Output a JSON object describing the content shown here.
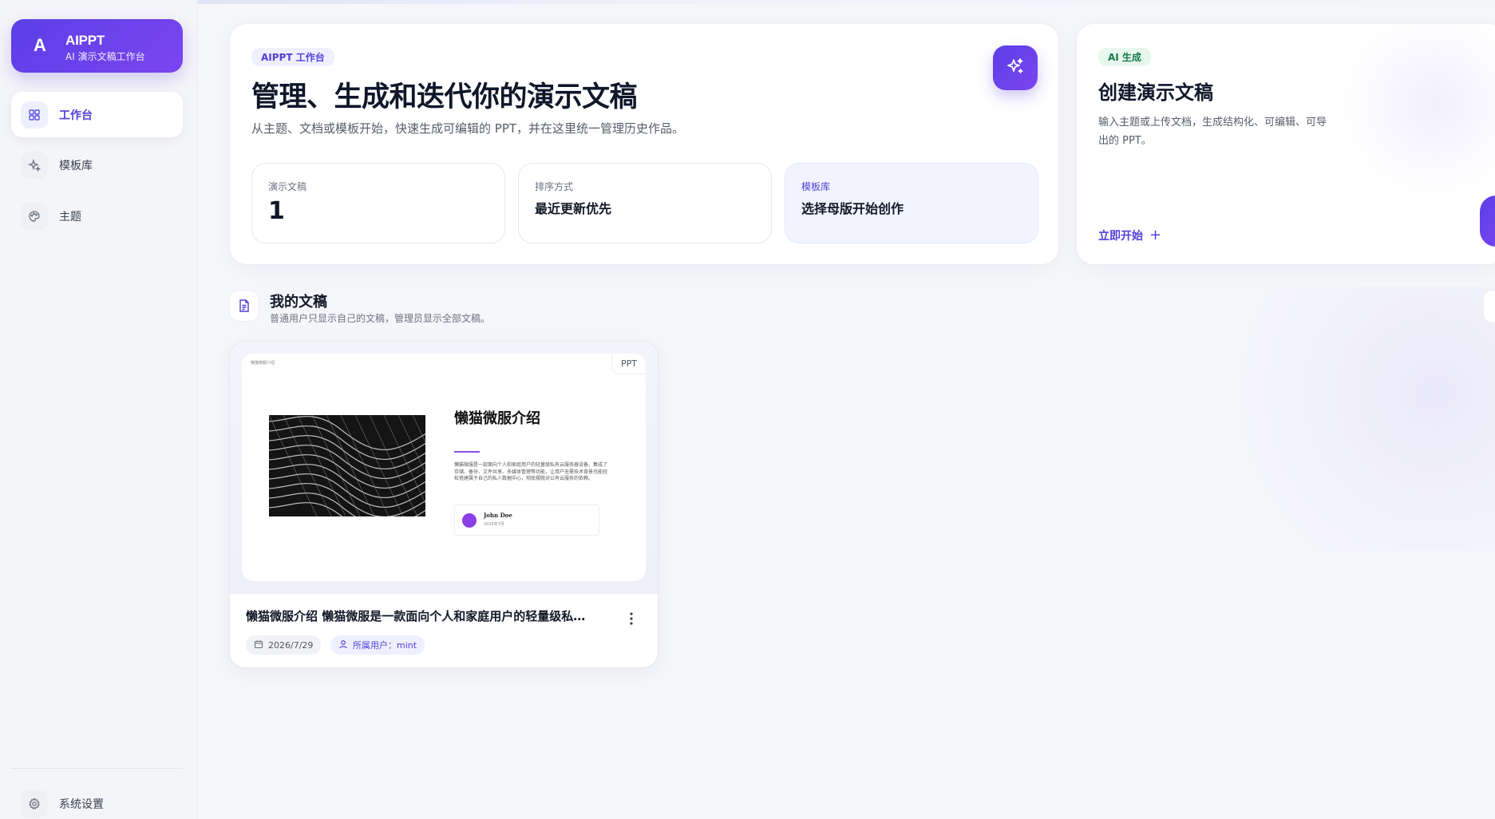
{
  "brand": {
    "letter": "A",
    "title": "AIPPT",
    "subtitle": "AI 演示文稿工作台"
  },
  "sidebar": {
    "items": [
      {
        "label": "工作台",
        "icon": "grid-icon",
        "active": true
      },
      {
        "label": "模板库",
        "icon": "sparkle-icon",
        "active": false
      },
      {
        "label": "主题",
        "icon": "palette-icon",
        "active": false
      }
    ],
    "settings": {
      "label": "系统设置",
      "icon": "gear-icon"
    }
  },
  "hero": {
    "badge": "AIPPT 工作台",
    "title": "管理、生成和迭代你的演示文稿",
    "subtitle": "从主题、文档或模板开始，快速生成可编辑的 PPT，并在这里统一管理历史作品。",
    "stats": [
      {
        "label": "演示文稿",
        "value": "1"
      },
      {
        "label": "排序方式",
        "value": "最近更新优先"
      },
      {
        "label": "模板库",
        "value": "选择母版开始创作"
      }
    ]
  },
  "ai_card": {
    "badge": "AI 生成",
    "title": "创建演示文稿",
    "description": "输入主题或上传文档，生成结构化、可编辑、可导出的 PPT。",
    "cta": "立即开始"
  },
  "documents_section": {
    "title": "我的文稿",
    "subtitle": "普通用户只显示自己的文稿，管理员显示全部文稿。"
  },
  "documents": [
    {
      "badge": "PPT",
      "slide": {
        "tiny_text": "懒猫微服介绍",
        "title": "懒猫微服介绍",
        "body": "懒猫微服是一款面向个人和家庭用户的轻量级私有云服务器设备。集成了存储、备份、文件共享、多媒体管理等功能，让用户无需技术背景也能轻松搭建属于自己的私人数据中心，彻底摆脱对公有云服务的依赖。",
        "author": "John Doe",
        "date": "2026年7月"
      },
      "title": "懒猫微服介绍 懒猫微服是一款面向个人和家庭用户的轻量级私有云服务器设备",
      "date": "2026/7/29",
      "owner": "所属用户：mint"
    }
  ],
  "colors": {
    "accent": "#5b3fe6",
    "accent_text": "#4f3fd9",
    "green_badge": "#16794a"
  }
}
